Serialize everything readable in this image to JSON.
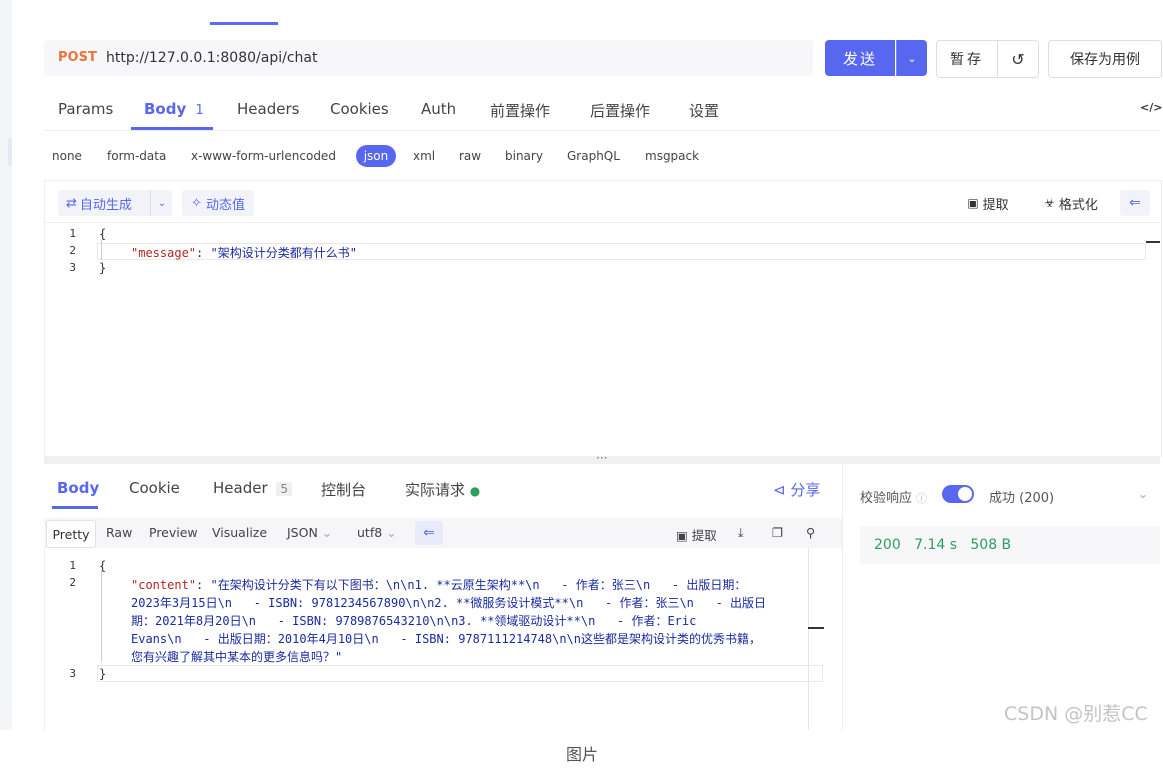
{
  "request": {
    "method": "POST",
    "url": "http://127.0.0.1:8080/api/chat",
    "send_label": "发送",
    "save_temp_label": "暂存",
    "save_case_label": "保存为用例"
  },
  "req_tabs": [
    {
      "label": "Params"
    },
    {
      "label": "Body",
      "badge": "1"
    },
    {
      "label": "Headers"
    },
    {
      "label": "Cookies"
    },
    {
      "label": "Auth"
    },
    {
      "label": "前置操作"
    },
    {
      "label": "后置操作"
    },
    {
      "label": "设置"
    }
  ],
  "code_toggle": "</>",
  "body_types": [
    "none",
    "form-data",
    "x-www-form-urlencoded",
    "json",
    "xml",
    "raw",
    "binary",
    "GraphQL",
    "msgpack"
  ],
  "editor_toolbar": {
    "auto_gen": "自动生成",
    "dynamic_value": "动态值",
    "extract": "提取",
    "format": "格式化"
  },
  "request_body": {
    "line_numbers": [
      "1",
      "2",
      "3"
    ],
    "open": "{",
    "key": "\"message\"",
    "colon": ": ",
    "value": "\"架构设计分类都有什么书\"",
    "close": "}"
  },
  "res_tabs": [
    {
      "label": "Body"
    },
    {
      "label": "Cookie"
    },
    {
      "label": "Header",
      "badge": "5"
    },
    {
      "label": "控制台"
    },
    {
      "label": "实际请求"
    }
  ],
  "share_label": "分享",
  "res_toolbar": {
    "pretty": "Pretty",
    "raw": "Raw",
    "preview": "Preview",
    "visualize": "Visualize",
    "format": "JSON",
    "encoding": "utf8",
    "extract": "提取"
  },
  "response_body": {
    "line_numbers": [
      "1",
      "2",
      "3"
    ],
    "open": "{",
    "key": "\"content\"",
    "colon": ": ",
    "lines": [
      "\"在架构设计分类下有以下图书：\\n\\n1. **云原生架构**\\n   - 作者：张三\\n   - 出版日期：",
      "2023年3月15日\\n   - ISBN: 9781234567890\\n\\n2. **微服务设计模式**\\n   - 作者：张三\\n   - 出版日",
      "期：2021年8月20日\\n   - ISBN: 9789876543210\\n\\n3. **领域驱动设计**\\n   - 作者：Eric",
      "Evans\\n   - 出版日期：2010年4月10日\\n   - ISBN: 9787111214748\\n\\n这些都是架构设计类的优秀书籍，",
      "您有兴趣了解其中某本的更多信息吗？\""
    ],
    "close": "}"
  },
  "validation": {
    "label": "校验响应",
    "result": "成功 (200)"
  },
  "status": {
    "code": "200",
    "time": "7.14 s",
    "size": "508 B"
  },
  "watermark": "CSDN @别惹CC",
  "caption": "图片",
  "colors": {
    "accent": "#5867f0",
    "method": "#e8753a",
    "success": "#2e9f5b"
  }
}
